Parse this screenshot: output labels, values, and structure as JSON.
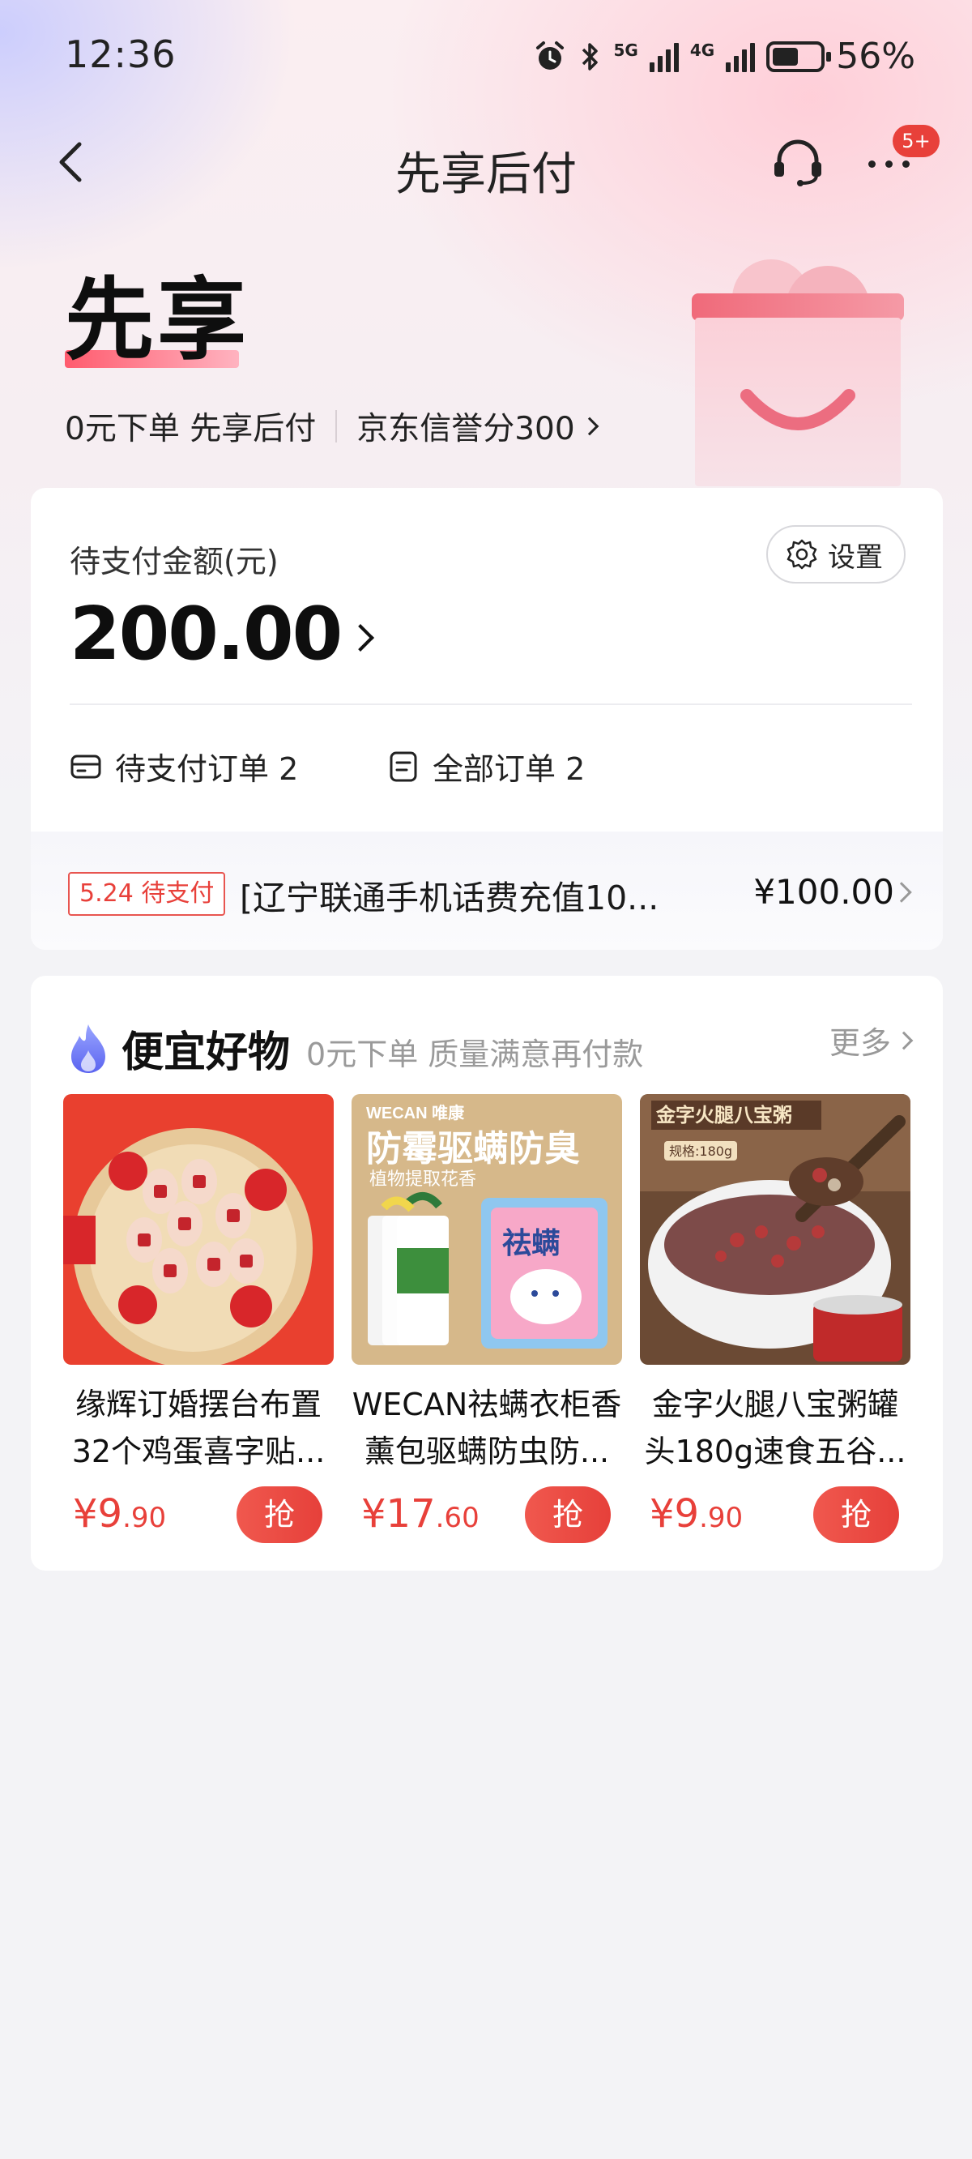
{
  "status_bar": {
    "time": "12:36",
    "signal_5g": "5G",
    "signal_4g": "4G",
    "battery_percent": "56%",
    "battery_level": 0.56
  },
  "nav": {
    "title": "先享后付",
    "badge": "5+"
  },
  "hero": {
    "title": "先享",
    "tagline": "0元下单 先享后付",
    "credit": "京东信誉分300"
  },
  "pending": {
    "label": "待支付金额(元)",
    "settings_label": "设置",
    "amount": "200.00",
    "pending_orders": "待支付订单 2",
    "all_orders": "全部订单 2"
  },
  "bill": {
    "tag": "5.24 待支付",
    "name": "[辽宁联通手机话费充值10...",
    "amount": "¥100.00"
  },
  "deals": {
    "title": "便宜好物",
    "subtitle": "0元下单 质量满意再付款",
    "more": "更多",
    "products": [
      {
        "name": "缘辉订婚摆台布置32个鸡蛋喜字贴...",
        "price_int": "¥9",
        "price_dec": ".90",
        "button": "抢"
      },
      {
        "name": "WECAN祛螨衣柜香薰包驱螨防虫防...",
        "price_int": "¥17",
        "price_dec": ".60",
        "button": "抢",
        "image_text": {
          "brand": "WECAN 唯康",
          "headline": "防霉驱螨防臭",
          "sub": "植物提取花香",
          "pack": "祛螨"
        }
      },
      {
        "name": "金字火腿八宝粥罐头180g速食五谷...",
        "price_int": "¥9",
        "price_dec": ".90",
        "button": "抢",
        "image_text": {
          "headline": "金字火腿八宝粥",
          "spec": "规格:180g"
        }
      }
    ]
  },
  "colors": {
    "accent_red": "#e8403a",
    "text_dark": "#111111",
    "muted": "#9a9a9a",
    "page_bg": "#f3f3f6"
  }
}
